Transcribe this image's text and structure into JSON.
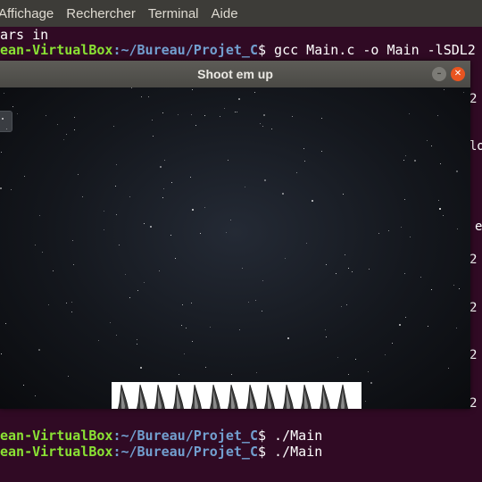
{
  "terminal": {
    "menu": [
      "Affichage",
      "Rechercher",
      "Terminal",
      "Aide"
    ],
    "lines": [
      {
        "text": "ars in"
      },
      {
        "user": "ean-VirtualBox",
        "path": ":~/Bureau/Projet_C",
        "cmd": "$ gcc Main.c -o Main -lSDL2"
      },
      {
        "user": "ean-VirtualBox",
        "path": ":~/Bureau/Projet_C",
        "cmd": "$ ./Main"
      },
      {
        "user": "ean-VirtualBox",
        "path": ":~/Bureau/Projet_C",
        "cmd": "$ ./Main"
      }
    ],
    "right_fragments": [
      "2",
      "lo",
      "e",
      "2",
      "2",
      "2",
      "2"
    ]
  },
  "sdl_window": {
    "title": "Shoot em up",
    "minimize_icon": "minimize-icon",
    "close_icon": "close-icon",
    "sprite_count": 13
  },
  "colors": {
    "terminal_bg": "#300a24",
    "prompt_user": "#8ae234",
    "prompt_path": "#729fcf",
    "close_button": "#e95420"
  }
}
